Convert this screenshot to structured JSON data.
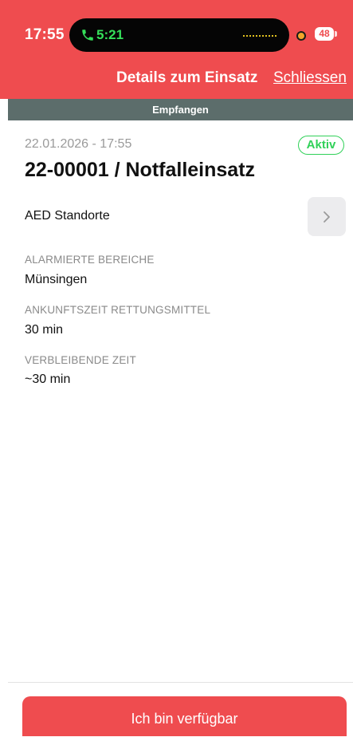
{
  "status_bar": {
    "time": "17:55",
    "call_timer": "5:21",
    "battery": "48"
  },
  "header": {
    "title": "Details zum Einsatz",
    "close_label": "Schliessen"
  },
  "state_bar": {
    "label": "Empfangen"
  },
  "incident": {
    "timestamp": "22.01.2026 - 17:55",
    "status": "Aktiv",
    "title": "22-00001 / Notfalleinsatz"
  },
  "aed": {
    "label": "AED Standorte"
  },
  "fields": [
    {
      "label": "ALARMIERTE BEREICHE",
      "value": "Münsingen"
    },
    {
      "label": "ANKUNFTSZEIT RETTUNGSMITTEL",
      "value": "30 min"
    },
    {
      "label": "VERBLEIBENDE ZEIT",
      "value": "~30 min"
    }
  ],
  "footer": {
    "button_label": "Ich bin verfügbar"
  },
  "colors": {
    "header_red": "#ef4c4f",
    "state_gray": "#5c6d6b",
    "active_green": "#30d158",
    "call_green": "#35e05a"
  },
  "icons": [
    "phone-icon",
    "waveform-icon",
    "battery-icon",
    "chevron-right-icon"
  ]
}
